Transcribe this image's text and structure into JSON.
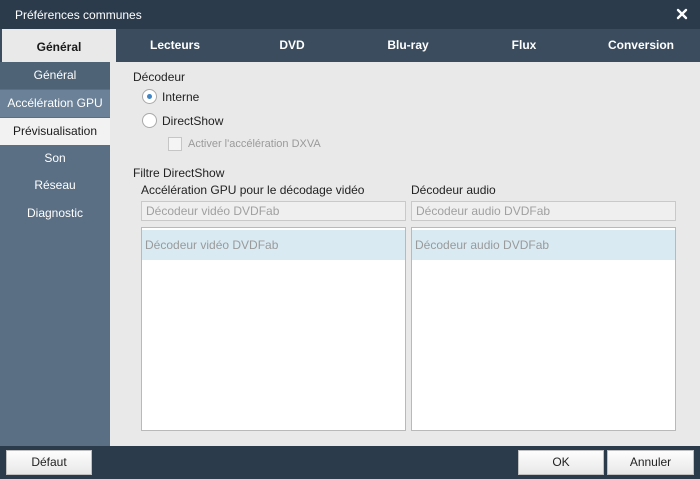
{
  "window": {
    "title": "Préférences communes"
  },
  "tabs": [
    {
      "label": "Général"
    },
    {
      "label": "Lecteurs"
    },
    {
      "label": "DVD"
    },
    {
      "label": "Blu-ray"
    },
    {
      "label": "Flux"
    },
    {
      "label": "Conversion"
    }
  ],
  "sidebar": {
    "items": [
      {
        "label": "Général"
      },
      {
        "label": "Accélération GPU"
      },
      {
        "label": "Prévisualisation"
      },
      {
        "label": "Son"
      },
      {
        "label": "Réseau"
      },
      {
        "label": "Diagnostic"
      }
    ]
  },
  "decoder": {
    "heading": "Décodeur",
    "options": [
      {
        "label": "Interne",
        "checked": true
      },
      {
        "label": "DirectShow",
        "checked": false
      }
    ],
    "dxva_label": "Activer l'accélération DXVA"
  },
  "directshow": {
    "heading": "Filtre DirectShow",
    "video": {
      "label": "Accélération GPU pour le décodage vidéo",
      "selected": "Décodeur vidéo DVDFab",
      "items": [
        "Décodeur vidéo DVDFab"
      ]
    },
    "audio": {
      "label": "Décodeur audio",
      "selected": "Décodeur audio DVDFab",
      "items": [
        "Décodeur audio DVDFab"
      ]
    }
  },
  "footer": {
    "default_label": "Défaut",
    "ok_label": "OK",
    "cancel_label": "Annuler"
  },
  "colors": {
    "accent": "#3f84c4",
    "titlebar": "#2c3b4b",
    "sidebar": "#5a6f84",
    "list_selection": "#d9eaf2"
  }
}
